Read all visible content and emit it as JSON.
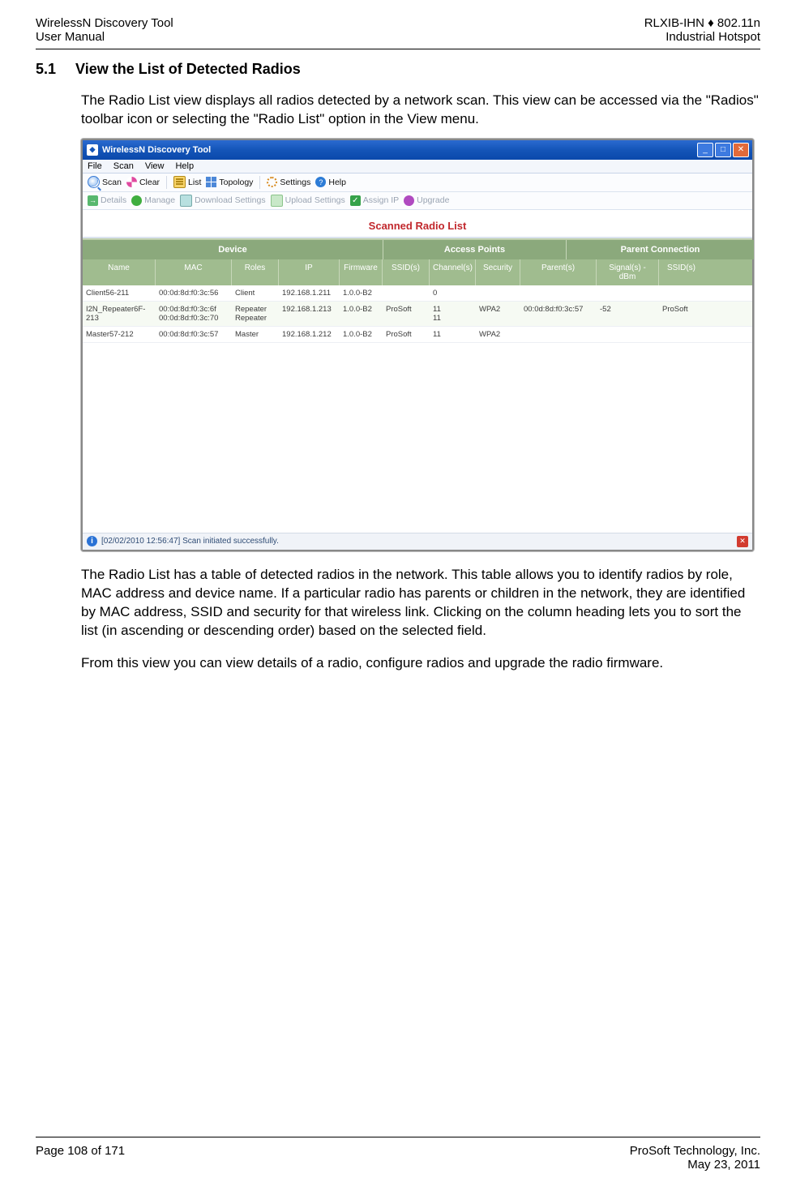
{
  "header": {
    "top_left_1": "WirelessN Discovery Tool",
    "top_left_2": "User Manual",
    "top_right_1": "RLXIB-IHN ♦ 802.11n",
    "top_right_2": "Industrial Hotspot"
  },
  "section": {
    "number": "5.1",
    "title": "View the List of Detected Radios"
  },
  "para1": "The Radio List view displays all radios detected by a network scan. This view can be accessed via the \"Radios\" toolbar icon or selecting the \"Radio List\" option in the View menu.",
  "para2": "The Radio List has a table of detected radios in the network. This table allows you to identify radios by role, MAC address and device name. If a particular radio has parents or children in the network, they are identified by MAC address, SSID and security for that wireless link. Clicking on the column heading lets you to sort the list (in ascending or descending order) based on the selected field.",
  "para3": "From this view you can view details of a radio, configure radios and upgrade the radio firmware.",
  "app": {
    "title": "WirelessN Discovery Tool",
    "menubar": [
      "File",
      "Scan",
      "View",
      "Help"
    ],
    "toolbar1": {
      "scan": "Scan",
      "clear": "Clear",
      "list": "List",
      "topology": "Topology",
      "settings": "Settings",
      "help": "Help"
    },
    "toolbar2": {
      "details": "Details",
      "manage": "Manage",
      "download": "Download Settings",
      "upload": "Upload Settings",
      "assign_ip": "Assign IP",
      "upgrade": "Upgrade"
    },
    "banner": "Scanned Radio List",
    "group_headers": {
      "device": "Device",
      "access_points": "Access Points",
      "parent_connection": "Parent Connection"
    },
    "columns": {
      "name": "Name",
      "mac": "MAC",
      "roles": "Roles",
      "ip": "IP",
      "firmware": "Firmware",
      "ssid": "SSID(s)",
      "channel": "Channel(s)",
      "security": "Security",
      "parent": "Parent(s)",
      "signal": "Signal(s) - dBm",
      "ssid2": "SSID(s)"
    },
    "rows": [
      {
        "name": "Client56-211",
        "mac": "00:0d:8d:f0:3c:56",
        "roles": "Client",
        "ip": "192.168.1.211",
        "firmware": "1.0.0-B2",
        "ssid": "",
        "channel": "0",
        "security": "",
        "parent": "",
        "signal": "",
        "ssid2": ""
      },
      {
        "name": "I2N_Repeater6F-213",
        "mac": "00:0d:8d:f0:3c:6f\n00:0d:8d:f0:3c:70",
        "roles": "Repeater\nRepeater",
        "ip": "192.168.1.213",
        "firmware": "1.0.0-B2",
        "ssid": "ProSoft",
        "channel": "11\n11",
        "security": "WPA2",
        "parent": "00:0d:8d:f0:3c:57",
        "signal": "-52",
        "ssid2": "ProSoft"
      },
      {
        "name": "Master57-212",
        "mac": "00:0d:8d:f0:3c:57",
        "roles": "Master",
        "ip": "192.168.1.212",
        "firmware": "1.0.0-B2",
        "ssid": "ProSoft",
        "channel": "11",
        "security": "WPA2",
        "parent": "",
        "signal": "",
        "ssid2": ""
      }
    ],
    "status": "[02/02/2010 12:56:47] Scan initiated successfully."
  },
  "footer": {
    "page": "Page 108 of 171",
    "company": "ProSoft Technology, Inc.",
    "date": "May 23, 2011"
  }
}
